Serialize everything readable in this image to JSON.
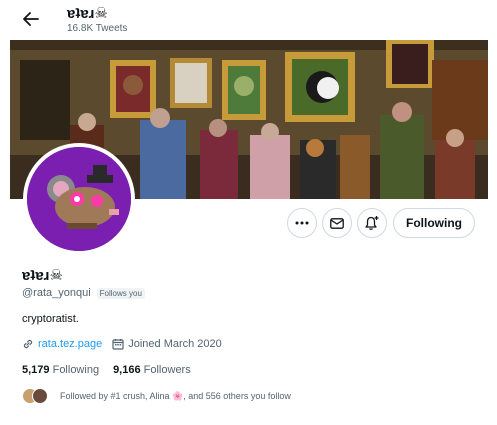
{
  "header": {
    "title": "ɐʇɐɹ☠",
    "tweet_count": "16.8K Tweets"
  },
  "profile": {
    "display_name": "ɐʇɐɹ☠",
    "handle": "@rata_yonqui",
    "follows_you": "Follows you",
    "bio": "cryptoratist.",
    "website": "rata.tez.page",
    "joined": "Joined March 2020",
    "following_count": "5,179",
    "following_label": "Following",
    "followers_count": "9,166",
    "followers_label": "Followers",
    "followed_by": "Followed by #1 crush, Alina 🌸, and 556 others you follow"
  },
  "actions": {
    "follow_label": "Following"
  },
  "icons": {
    "back": "arrow-left-icon",
    "more": "more-icon",
    "message": "envelope-icon",
    "notify": "bell-plus-icon",
    "link": "link-icon",
    "calendar": "calendar-icon"
  },
  "colors": {
    "accent": "#1d9bf0",
    "avatar_bg": "#7a1fb0",
    "text": "#0f1419",
    "secondary": "#536471"
  }
}
